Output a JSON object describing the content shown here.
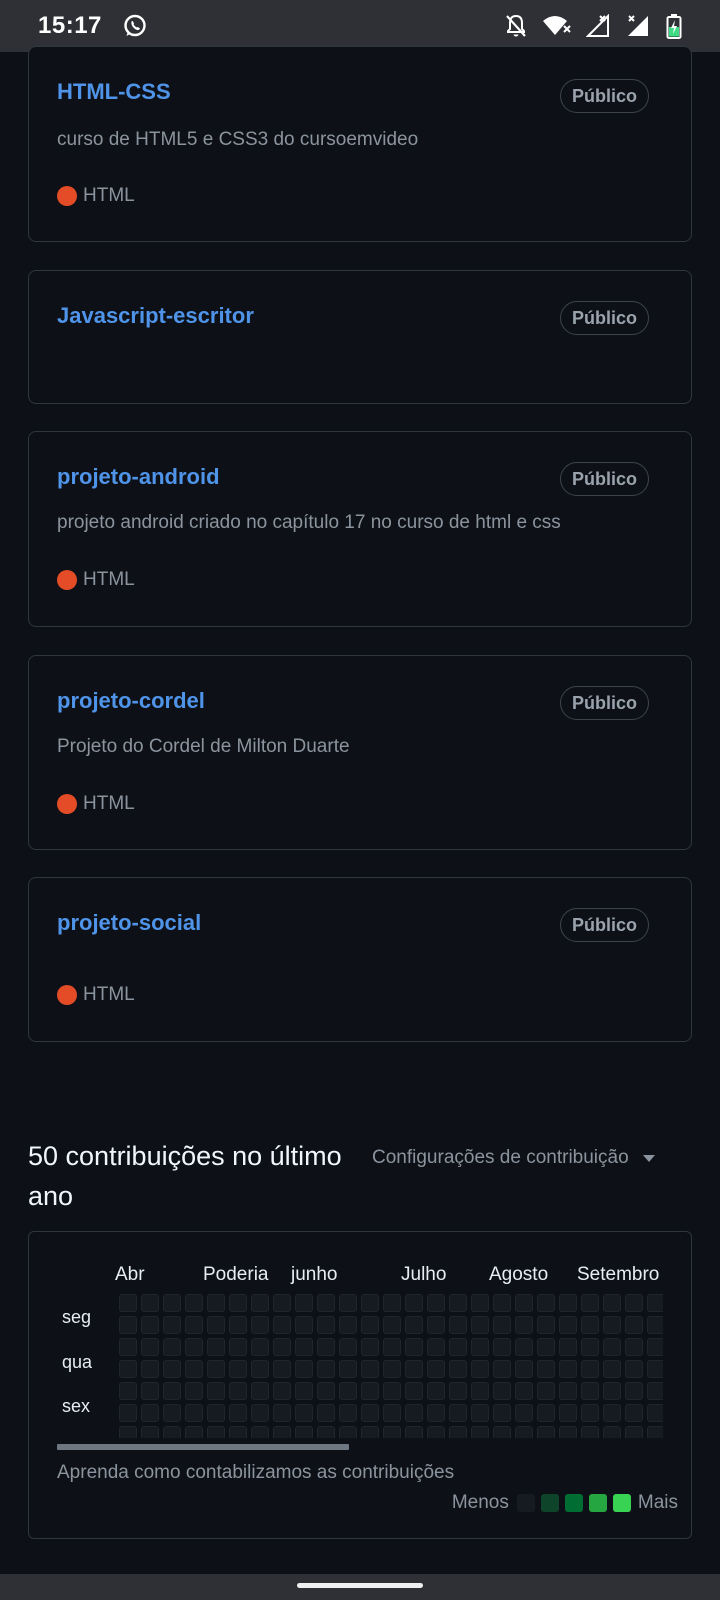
{
  "status_bar": {
    "time": "15:17",
    "icons": [
      "whatsapp-icon",
      "notifications-off-icon",
      "wifi-icon",
      "signal-icon",
      "signal-icon",
      "battery-charging-icon"
    ]
  },
  "repos": [
    {
      "name": "HTML-CSS",
      "badge": "Público",
      "description": "curso de HTML5 e CSS3 do cursoemvideo",
      "language": "HTML"
    },
    {
      "name": "Javascript-escritor",
      "badge": "Público",
      "description": "",
      "language": ""
    },
    {
      "name": "projeto-android",
      "badge": "Público",
      "description": "projeto android criado no capítulo 17 no curso de html e css",
      "language": "HTML"
    },
    {
      "name": "projeto-cordel",
      "badge": "Público",
      "description": "Projeto do Cordel de Milton Duarte",
      "language": "HTML"
    },
    {
      "name": "projeto-social",
      "badge": "Público",
      "description": "",
      "language": "HTML"
    }
  ],
  "colors": {
    "repo_link": "#4f94e9",
    "html_language": "#e34c26",
    "background": "#0d1117",
    "legend_levels": [
      "#161b22",
      "#0e4429",
      "#006d32",
      "#26a641",
      "#39d353"
    ]
  },
  "contributions": {
    "title": "50 contribuições no último ano",
    "settings_label": "Configurações de contribuição",
    "months": [
      "Abr",
      "Poderia",
      "junho",
      "Julho",
      "Agosto",
      "Setembro"
    ],
    "days": [
      "seg",
      "qua",
      "sex"
    ],
    "learn_text": "Aprenda como contabilizamos as contribuições",
    "legend_less": "Menos",
    "legend_more": "Mais"
  }
}
